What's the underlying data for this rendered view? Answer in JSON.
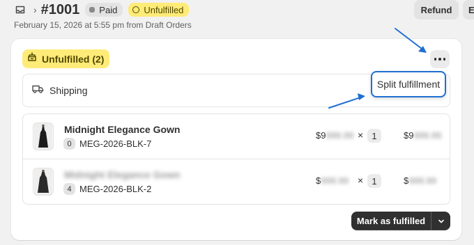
{
  "header": {
    "order_number": "#1001",
    "breadcrumb_separator": "›",
    "paid_badge": "Paid",
    "unfulfilled_badge": "Unfulfilled",
    "subtitle": "February 15, 2026 at 5:55 pm from Draft Orders",
    "refund_label": "Refund",
    "edit_label": "E"
  },
  "fulfillment_card": {
    "badge_label": "Unfulfilled (2)",
    "shipping_label": "Shipping",
    "items": [
      {
        "name": "Midnight Elegance Gown",
        "qty_badge": "0",
        "sku": "MEG-2026-BLK-7",
        "price_symbol": "$",
        "price_hidden": "9",
        "price_blurred": "999.99",
        "multiply": "×",
        "quantity": "1",
        "total_symbol": "$",
        "total_hidden": "9",
        "total_blurred": "999.99"
      },
      {
        "name": "Midnight Elegance Gown",
        "qty_badge": "4",
        "sku": "MEG-2026-BLK-2",
        "price_symbol": "$",
        "price_hidden": "",
        "price_blurred": "999.99",
        "multiply": "×",
        "quantity": "1",
        "total_symbol": "$",
        "total_hidden": "",
        "total_blurred": "999.99"
      }
    ],
    "mark_fulfilled_label": "Mark as fulfilled",
    "popover_item": "Split fulfillment"
  },
  "colors": {
    "unfulfilled_bg": "#ffeb78",
    "primary_button": "#303030",
    "annotation_blue": "#1f6fd1"
  }
}
